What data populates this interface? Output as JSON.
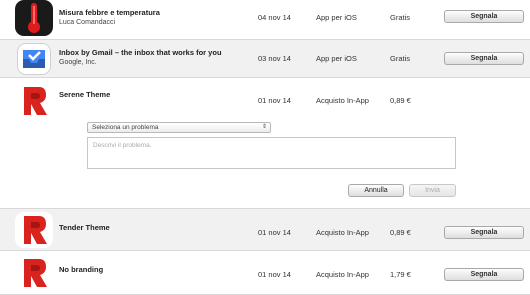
{
  "rows": [
    {
      "title": "Misura febbre e temperatura",
      "subtitle": "Luca Comandacci",
      "date": "04 nov 14",
      "kind": "App per iOS",
      "price": "Gratis",
      "action": "Segnala",
      "icon": "thermometer-icon"
    },
    {
      "title": "Inbox by Gmail – the inbox that works for you",
      "subtitle": "Google, Inc.",
      "date": "03 nov 14",
      "kind": "App per iOS",
      "price": "Gratis",
      "action": "Segnala",
      "icon": "inbox-icon"
    },
    {
      "title": "Serene Theme",
      "subtitle": "",
      "date": "01 nov 14",
      "kind": "Acquisto In-App",
      "price": "0,89 €",
      "action": "",
      "icon": "app-r-icon"
    },
    {
      "title": "Tender Theme",
      "subtitle": "",
      "date": "01 nov 14",
      "kind": "Acquisto In-App",
      "price": "0,89 €",
      "action": "Segnala",
      "icon": "app-r-icon"
    },
    {
      "title": "No branding",
      "subtitle": "",
      "date": "01 nov 14",
      "kind": "Acquisto In-App",
      "price": "1,79 €",
      "action": "Segnala",
      "icon": "app-r-icon"
    }
  ],
  "report_form": {
    "problem_select": "Seleziona un problema",
    "description_placeholder": "Descrivi il problema.",
    "cancel": "Annulla",
    "send": "Invia"
  },
  "colors": {
    "thermometer_bg": "#1a1a1a",
    "thermometer_red": "#e01b1b",
    "inbox_blue": "#4285f4",
    "app_red": "#d9231f"
  }
}
